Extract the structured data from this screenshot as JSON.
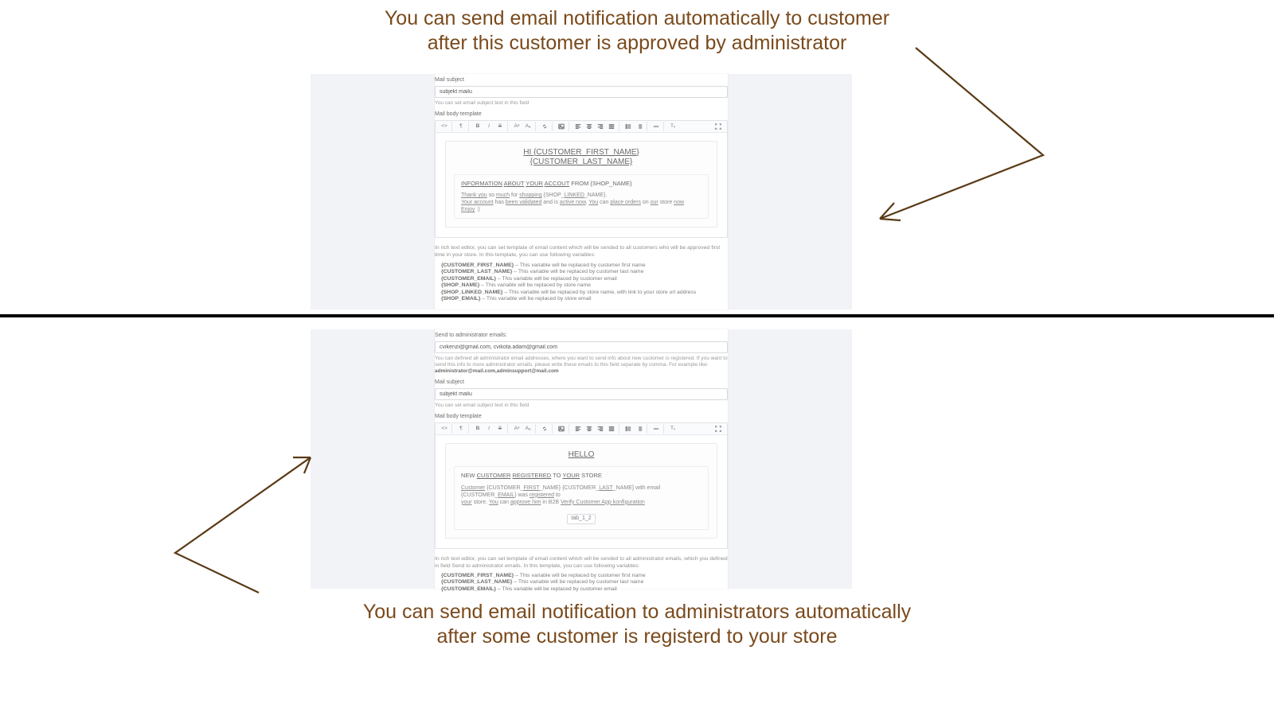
{
  "captions": {
    "top_l1": "You can send email notification automatically to customer",
    "top_l2": "after this customer is approved by administrator",
    "bottom_l1": "You can send email notification to administrators automatically",
    "bottom_l2": "after some customer is registerd to your store"
  },
  "panel1": {
    "subject_label": "Mail subject",
    "subject_value": "subjekt mailu",
    "subject_help": "You can set email subject text in this field",
    "body_label": "Mail body template",
    "ed_title_l1": "HI {CUSTOMER_FIRST_NAME}",
    "ed_title_l2": "{CUSTOMER_LAST_NAME}",
    "sec_head_pre": "INFORMATION",
    "sec_head_u1": "ABOUT",
    "sec_head_u2": "YOUR",
    "sec_head_u3": "ACCOUT",
    "sec_head_mid": " FROM {SHOP_NAME}",
    "body_a": "Thank you",
    "body_a2": " so ",
    "body_a3": "much",
    "body_a4": " for ",
    "body_a5": "shopping",
    "body_a6": " {SHOP_",
    "body_a7": "LINKED",
    "body_a8": "_NAME}.",
    "body_b": "Your account",
    "body_b2": " has ",
    "body_b3": "been validated",
    "body_b4": " and is ",
    "body_b5": "active now",
    "body_b6": ". ",
    "body_b7": "You",
    "body_b8": " can ",
    "body_b9": "place orders",
    "body_b10": " on ",
    "body_b11": "our",
    "body_b12": " store ",
    "body_b13": "now",
    "body_c": "Enjoy",
    "body_c2": " :)",
    "desc": "In rich text editor, you can set template of email content which will be sended to all customers who will be approved first time in your store. In this template, you can use following variables:",
    "vars": [
      {
        "k": "{CUSTOMER_FIRST_NAME}",
        "v": " – This variable will be replaced by customer first name"
      },
      {
        "k": "{CUSTOMER_LAST_NAME}",
        "v": " – This variable will be replaced by customer last name"
      },
      {
        "k": "{CUSTOMER_EMAIL}",
        "v": " – This variable will be replaced by customer email"
      },
      {
        "k": "{SHOP_NAME}",
        "v": " – This variable will be replaced by store name"
      },
      {
        "k": "{SHOP_LINKED_NAME}",
        "v": " – This variable will be replaced by store name, with link to your store url address"
      },
      {
        "k": "{SHOP_EMAIL}",
        "v": " – This variable will be replaced by store email"
      }
    ]
  },
  "panel2": {
    "admin_label": "Send to administrator emails:",
    "admin_value": "cvikenzi@gmail.com, cvikota.adam@gmail.com",
    "admin_help_a": "You can defined all administrator email addresses, where you want to send info about new customer is registered. If you want to send this info to more administrator emails, please write these emails to this field separate by comma. For example like:",
    "admin_help_b": "administrator@mail.com,adminsupport@mail.com",
    "subject_label": "Mail subject",
    "subject_value": "subjekt mailu",
    "subject_help": "You can set email subject text in this field",
    "body_label": "Mail body template",
    "ed_title": "HELLO",
    "sec_head_a": "NEW ",
    "sec_head_b": "CUSTOMER",
    "sec_head_c": " ",
    "sec_head_d": "REGISTERED",
    "sec_head_e": " TO ",
    "sec_head_f": "YOUR",
    "sec_head_g": " STORE",
    "body2_a": "Customer",
    "body2_b": " {CUSTOMER_",
    "body2_c": "FIRST",
    "body2_d": "_NAME} {CUSTOMER_",
    "body2_e": "LAST",
    "body2_f": "_NAME} with email {CUSTOMER_",
    "body2_g": "EMAIL",
    "body2_h": "} was ",
    "body2_i": "registered",
    "body2_j": " to",
    "body2_k": "your",
    "body2_l": " store. ",
    "body2_m": "You",
    "body2_n": " can ",
    "body2_o": "approve him",
    "body2_p": " in B2B ",
    "body2_q": "Verify Customer App konfiguration",
    "pill": "tab_1_2",
    "desc": "In rich text editor, you can set template of email content which will be sended to all administrator emails, which you defined in field Send to administrator emails. In this template, you can use following variables:",
    "vars": [
      {
        "k": "{CUSTOMER_FIRST_NAME}",
        "v": " – This variable will be replaced by customer first name"
      },
      {
        "k": "{CUSTOMER_LAST_NAME}",
        "v": " – This variable will be replaced by customer last name"
      },
      {
        "k": "{CUSTOMER_EMAIL}",
        "v": " – This variable will be replaced by customer email"
      }
    ]
  },
  "tb": {
    "code": "<>",
    "para": "¶",
    "bold": "B",
    "italic": "I",
    "strike": "S",
    "sup": "Aᵃ",
    "sub": "Aₐ",
    "link": "🔗",
    "image": "img",
    "al": "L",
    "ac": "C",
    "ar": "R",
    "aj": "J",
    "ul": "•",
    "ol": "1.",
    "hr": "—",
    "clr": "Tₓ",
    "full": "⛶"
  }
}
